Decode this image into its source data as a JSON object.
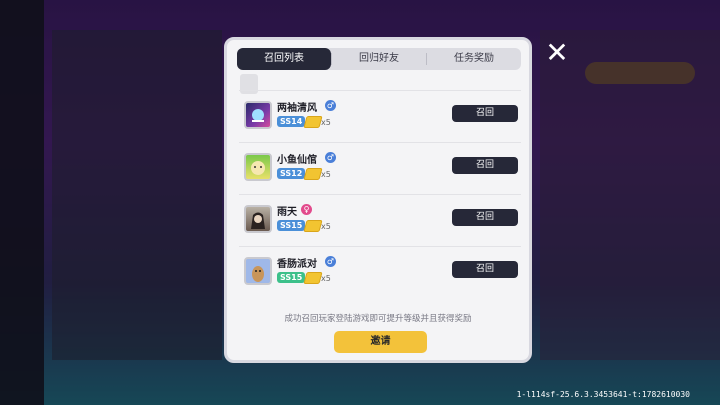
{
  "tabs": [
    {
      "label": "召回列表",
      "active": true
    },
    {
      "label": "回归好友",
      "active": false
    },
    {
      "label": "任务奖励",
      "active": false
    }
  ],
  "rows": [
    {
      "name": "两袖清风",
      "gender": "male",
      "level": "SS14",
      "reward_count": "x5",
      "button": "召回"
    },
    {
      "name": "小鱼仙倌",
      "gender": "male",
      "level": "SS12",
      "reward_count": "x5",
      "button": "召回"
    },
    {
      "name": "雨天",
      "gender": "female",
      "level": "SS15",
      "reward_count": "x5",
      "button": "召回"
    },
    {
      "name": "香肠派对",
      "gender": "male",
      "level": "SS15",
      "reward_count": "x5",
      "button": "召回"
    }
  ],
  "hint": "成功召回玩家登陆游戏即可提升等级并且获得奖励",
  "invite_label": "邀请",
  "close_label": "✕",
  "version": "1-l114sf-25.6.3.3453641-t:1782610030",
  "colors": {
    "male": "#4a7fd8",
    "female": "#e24a8c",
    "accent": "#f3c23a",
    "dark": "#262838"
  }
}
